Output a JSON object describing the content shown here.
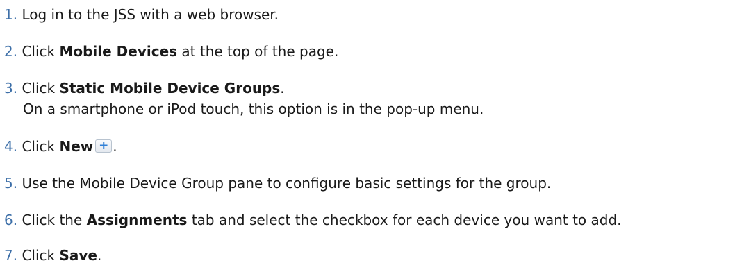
{
  "steps": [
    {
      "number": "1.",
      "parts": [
        "Log in to the JSS with a web browser."
      ]
    },
    {
      "number": "2.",
      "parts": [
        "Click ",
        "Mobile Devices",
        " at the top of the page."
      ]
    },
    {
      "number": "3.",
      "parts": [
        "Click ",
        "Static Mobile Device Groups",
        "."
      ],
      "note": "On a smartphone or iPod touch, this option is in the pop-up menu."
    },
    {
      "number": "4.",
      "parts": [
        "Click ",
        "New",
        "."
      ],
      "icon": "plus-icon",
      "icon_glyph": "+"
    },
    {
      "number": "5.",
      "parts": [
        "Use the Mobile Device Group pane to configure basic settings for the group."
      ]
    },
    {
      "number": "6.",
      "parts": [
        "Click the ",
        "Assignments",
        " tab and select the checkbox for each device you want to add."
      ]
    },
    {
      "number": "7.",
      "parts": [
        "Click ",
        "Save",
        "."
      ]
    }
  ],
  "colors": {
    "step_number": "#3d6fa8",
    "text": "#1a1a1a",
    "plus_icon": "#2f7fd6"
  }
}
